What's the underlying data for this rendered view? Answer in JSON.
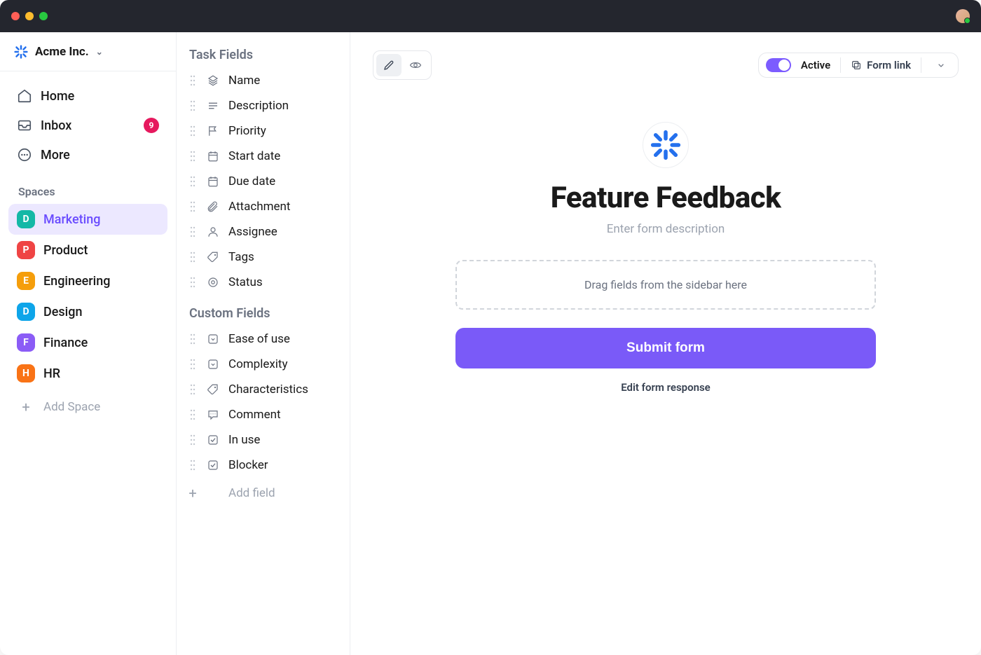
{
  "org": {
    "name": "Acme Inc."
  },
  "nav": {
    "home": "Home",
    "inbox": "Inbox",
    "inbox_badge": "9",
    "more": "More"
  },
  "spaces_label": "Spaces",
  "spaces": [
    {
      "letter": "D",
      "label": "Marketing",
      "color": "#14b8a6",
      "active": true
    },
    {
      "letter": "P",
      "label": "Product",
      "color": "#ef4444",
      "active": false
    },
    {
      "letter": "E",
      "label": "Engineering",
      "color": "#f59e0b",
      "active": false
    },
    {
      "letter": "D",
      "label": "Design",
      "color": "#0ea5e9",
      "active": false
    },
    {
      "letter": "F",
      "label": "Finance",
      "color": "#8b5cf6",
      "active": false
    },
    {
      "letter": "H",
      "label": "HR",
      "color": "#f97316",
      "active": false
    }
  ],
  "add_space": "Add Space",
  "fields": {
    "task_heading": "Task Fields",
    "task": [
      {
        "icon": "layers",
        "label": "Name"
      },
      {
        "icon": "lines",
        "label": "Description"
      },
      {
        "icon": "flag",
        "label": "Priority"
      },
      {
        "icon": "calendar",
        "label": "Start date"
      },
      {
        "icon": "calendar",
        "label": "Due date"
      },
      {
        "icon": "attachment",
        "label": "Attachment"
      },
      {
        "icon": "person",
        "label": "Assignee"
      },
      {
        "icon": "tag",
        "label": "Tags"
      },
      {
        "icon": "status",
        "label": "Status"
      }
    ],
    "custom_heading": "Custom Fields",
    "custom": [
      {
        "icon": "dropdown",
        "label": "Ease of use"
      },
      {
        "icon": "dropdown",
        "label": "Complexity"
      },
      {
        "icon": "tag",
        "label": "Characteristics"
      },
      {
        "icon": "comment",
        "label": "Comment"
      },
      {
        "icon": "checkbox",
        "label": "In use"
      },
      {
        "icon": "checkbox",
        "label": "Blocker"
      }
    ],
    "add_field": "Add field"
  },
  "topbar": {
    "active_label": "Active",
    "form_link": "Form link"
  },
  "form": {
    "title": "Feature Feedback",
    "description_placeholder": "Enter form description",
    "dropzone": "Drag fields from the sidebar here",
    "submit": "Submit form",
    "edit_response": "Edit form response"
  }
}
